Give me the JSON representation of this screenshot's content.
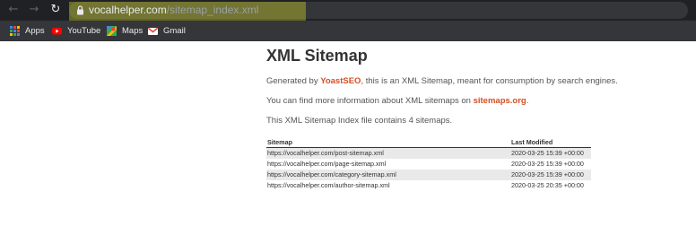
{
  "browser": {
    "url_host": "vocalhelper.com",
    "url_path": "/sitemap_index.xml"
  },
  "bookmarks": [
    {
      "label": "Apps",
      "icon": "apps-grid-icon"
    },
    {
      "label": "YouTube",
      "icon": "youtube-icon"
    },
    {
      "label": "Maps",
      "icon": "maps-icon"
    },
    {
      "label": "Gmail",
      "icon": "gmail-icon"
    }
  ],
  "page": {
    "title": "XML Sitemap",
    "generated_prefix": "Generated by ",
    "generated_link": "YoastSEO",
    "generated_suffix": ", this is an XML Sitemap, meant for consumption by search engines.",
    "info_prefix": "You can find more information about XML sitemaps on ",
    "info_link": "sitemaps.org",
    "info_suffix": ".",
    "count_text": "This XML Sitemap Index file contains 4 sitemaps."
  },
  "table": {
    "headers": {
      "sitemap": "Sitemap",
      "last_modified": "Last Modified"
    },
    "rows": [
      {
        "url": "https://vocalhelper.com/post-sitemap.xml",
        "modified": "2020-03-25 15:39 +00:00"
      },
      {
        "url": "https://vocalhelper.com/page-sitemap.xml",
        "modified": "2020-03-25 15:39 +00:00"
      },
      {
        "url": "https://vocalhelper.com/category-sitemap.xml",
        "modified": "2020-03-25 15:39 +00:00"
      },
      {
        "url": "https://vocalhelper.com/author-sitemap.xml",
        "modified": "2020-03-25 20:35 +00:00"
      }
    ]
  },
  "colors": {
    "link": "#d54e21",
    "row_stripe": "#e9e9e9",
    "chrome_bg": "#202124"
  }
}
